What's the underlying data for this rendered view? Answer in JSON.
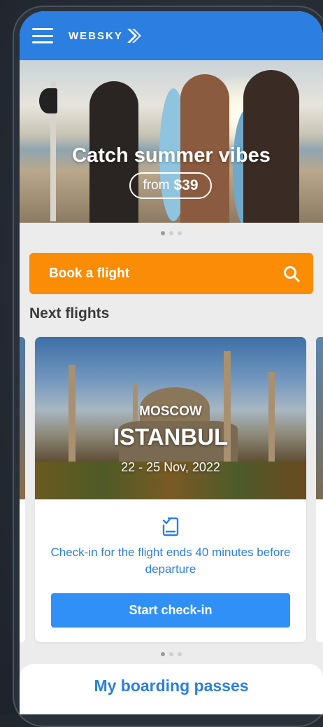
{
  "header": {
    "logo_text": "WEBSKY",
    "menu_icon": "hamburger-icon"
  },
  "hero": {
    "title": "Catch summer vibes",
    "price_prefix": "from",
    "price": "$39",
    "carousel_pages": 3,
    "carousel_active": 1
  },
  "book_button": {
    "label": "Book a flight",
    "icon": "search-icon"
  },
  "next_flights": {
    "title": "Next flights",
    "cards": [
      {
        "from_city": "MOSCOW",
        "to_city": "ISTANBUL",
        "dates": "22 - 25 Nov, 2022",
        "checkin_icon": "checkin-icon",
        "checkin_note": "Check-in for the flight ends 40 minutes before departure",
        "button_label": "Start check-in"
      }
    ],
    "carousel_pages": 3,
    "carousel_active": 1
  },
  "boarding_passes": {
    "label": "My boarding passes"
  },
  "colors": {
    "brand_blue": "#2b7fe0",
    "button_blue": "#3190f5",
    "accent_orange": "#fa8c06"
  }
}
